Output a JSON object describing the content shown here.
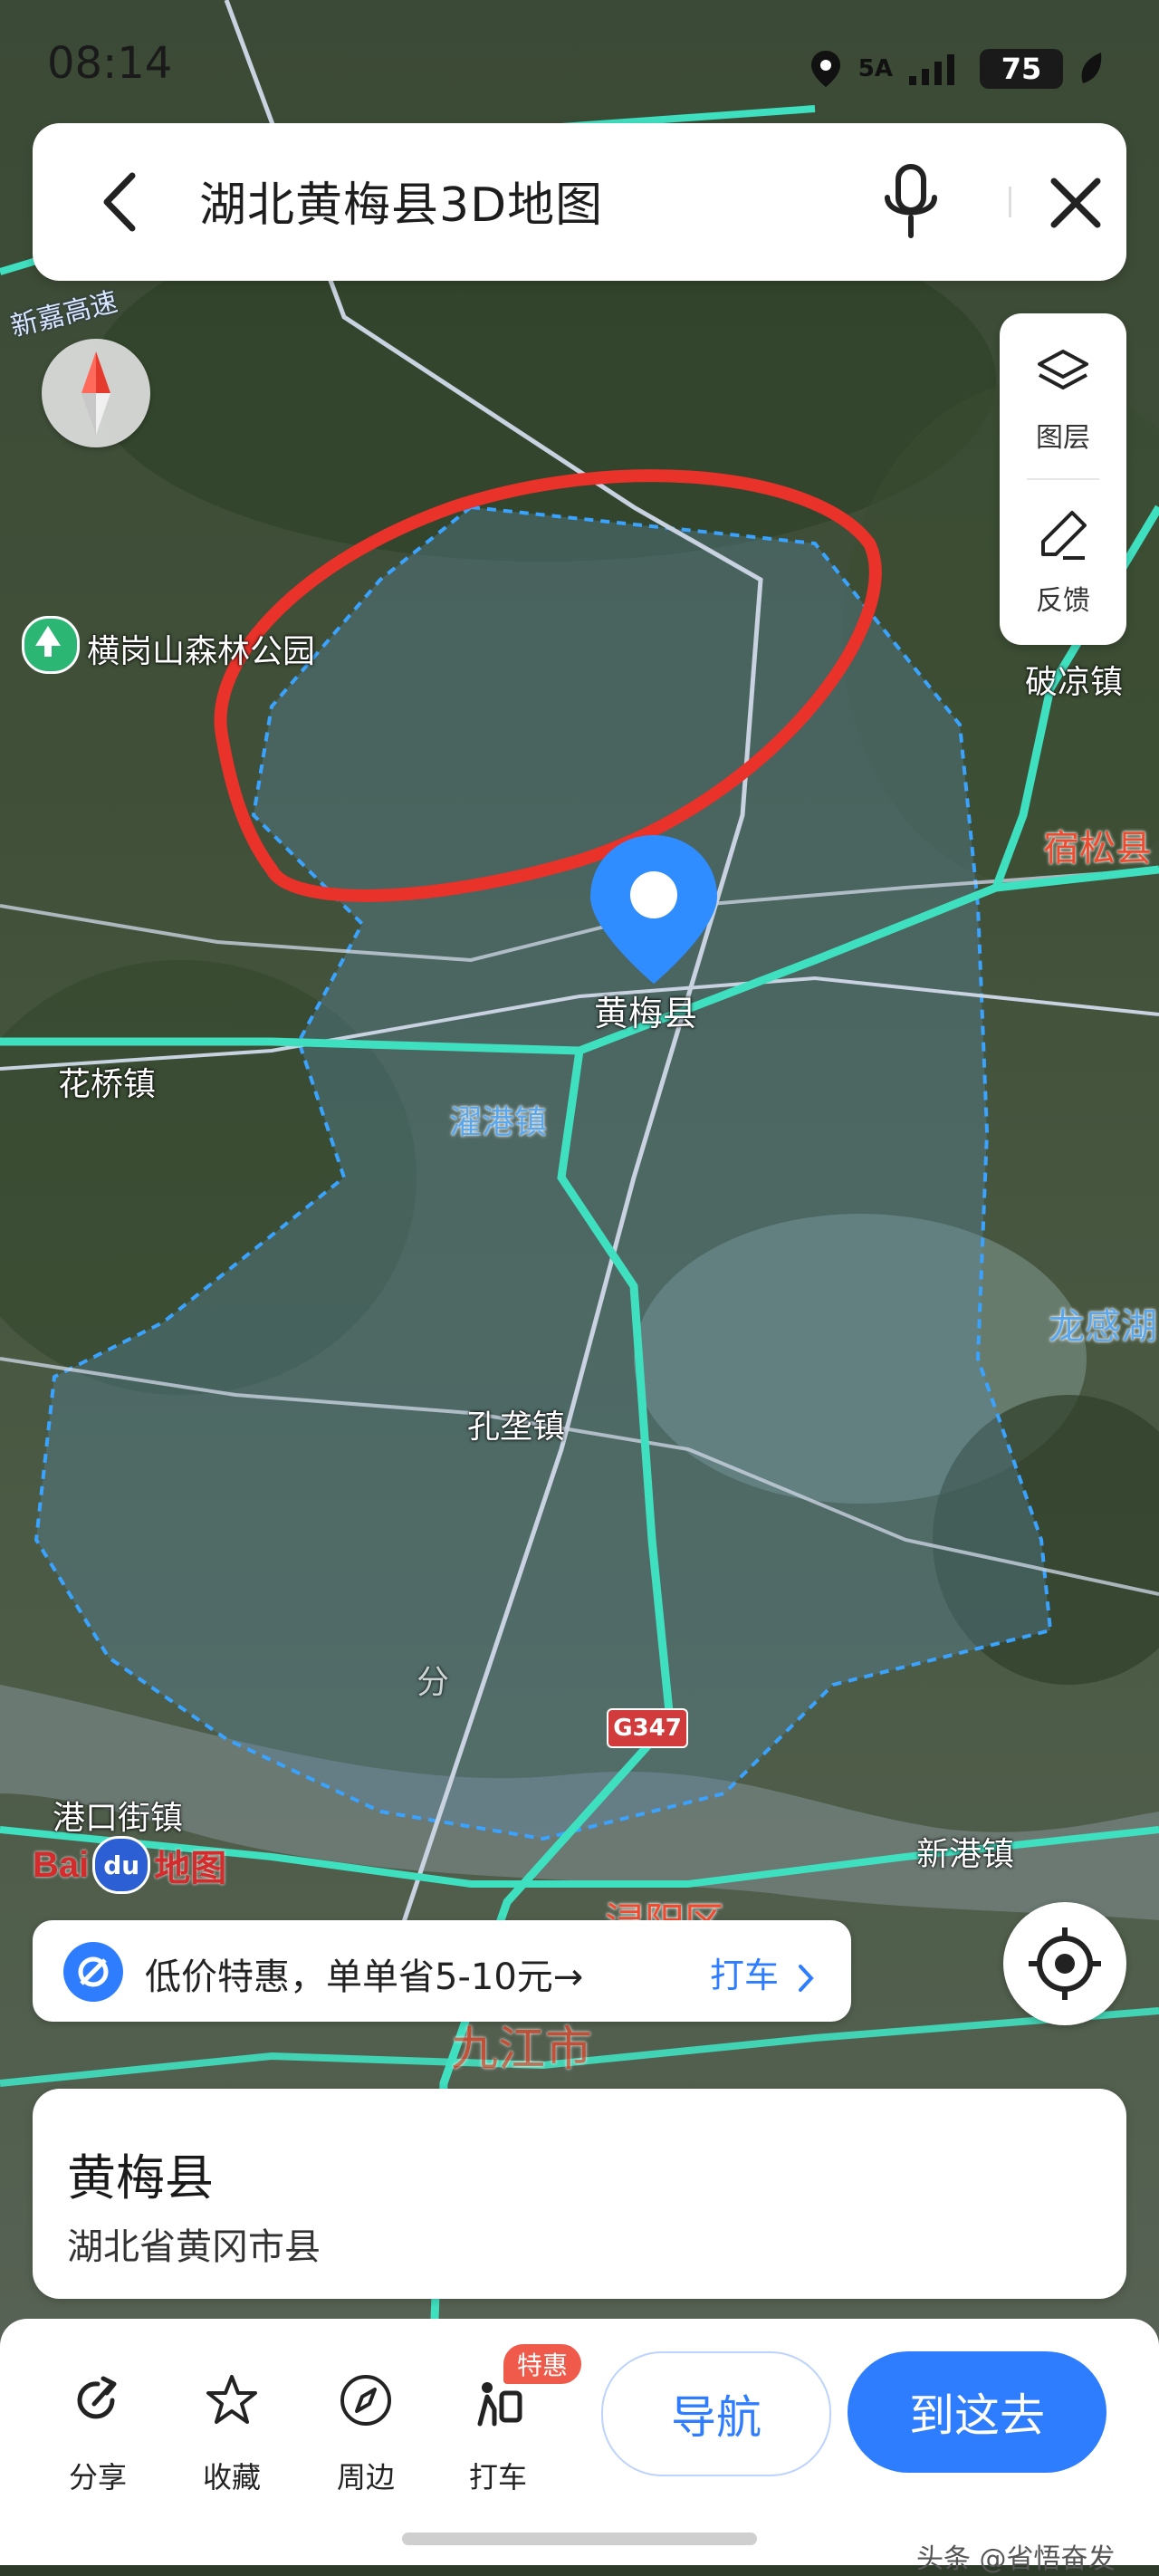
{
  "status_bar": {
    "time": "08:14",
    "network": "5A",
    "battery": "75"
  },
  "search": {
    "query": "湖北黄梅县3D地图"
  },
  "tools": [
    {
      "label": "图层",
      "icon": "layers-icon"
    },
    {
      "label": "反馈",
      "icon": "feedback-pen-icon"
    }
  ],
  "map": {
    "labels": {
      "xinjia": "新嘉高速",
      "park": "横岗山森林公园",
      "polang": "破凉镇",
      "susong": "宿松县",
      "huangmei": "黄梅县",
      "huaqiao": "花桥镇",
      "zhuogang": "濯港镇",
      "longgan": "龙感湖",
      "kongzhong": "孔垄镇",
      "fenlu": "分",
      "road": "G347",
      "gangkou": "港口街镇",
      "xingang": "新港镇",
      "xunyang": "浔阳区",
      "jiujiang": "九江市"
    },
    "logo": {
      "bai": "Bai",
      "du": "du",
      "ditu": "地图"
    },
    "colors": {
      "highlight": "#e8322a",
      "boundary": "#3aa3ff",
      "road": "#3fe0c0"
    }
  },
  "promo": {
    "text": "低价特惠，单单省5-10元→",
    "link": "打车"
  },
  "place": {
    "name": "黄梅县",
    "subtitle": "湖北省黄冈市县"
  },
  "actions": [
    {
      "label": "分享",
      "icon": "share-icon"
    },
    {
      "label": "收藏",
      "icon": "star-icon"
    },
    {
      "label": "周边",
      "icon": "compass-icon"
    },
    {
      "label": "打车",
      "icon": "taxi-icon"
    }
  ],
  "badge": "特惠",
  "buttons": {
    "navigate": "导航",
    "go_here": "到这去"
  },
  "watermark": "头条 @省悟奋发"
}
